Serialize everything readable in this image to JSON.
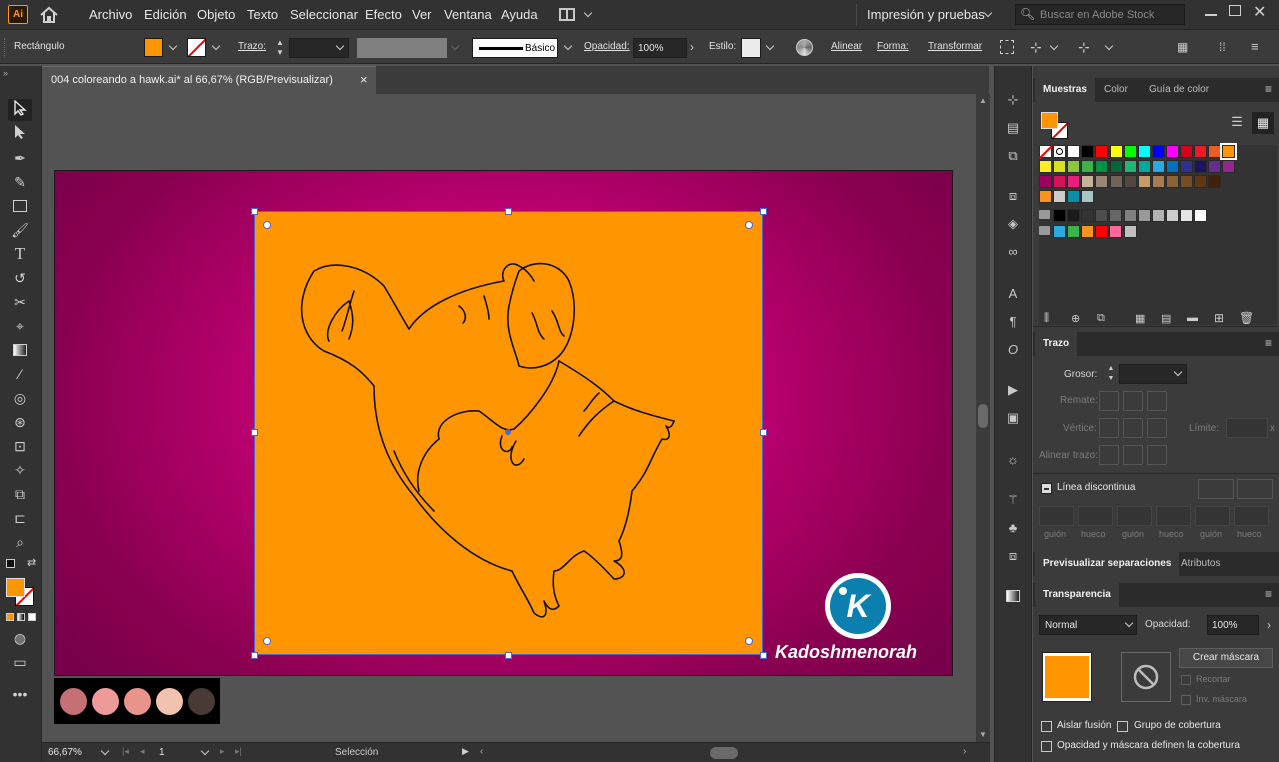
{
  "app": {
    "logo": "Ai",
    "home_icon": "home-icon"
  },
  "menu": [
    "Archivo",
    "Edición",
    "Objeto",
    "Texto",
    "Seleccionar",
    "Efecto",
    "Ver",
    "Ventana",
    "Ayuda"
  ],
  "workspace": "Impresión y pruebas",
  "search": {
    "placeholder": "Buscar en Adobe Stock"
  },
  "control": {
    "object_type": "Rectángulo",
    "fill_color": "#ff9500",
    "stroke_label": "Trazo:",
    "brush_label": "Básico",
    "opacity_label": "Opacidad:",
    "opacity_value": "100%",
    "style_label": "Estilo:",
    "align_label": "Alinear",
    "shape_label": "Forma:",
    "transform_label": "Transformar"
  },
  "document": {
    "tab_title": "004 coloreando a hawk.ai* al 66,67% (RGB/Previsualizar)",
    "close": "×"
  },
  "artboard": {
    "bg_color": "#c0006a",
    "rect_color": "#ff9500",
    "watermark": "Kadoshmenorah",
    "logo_letter": "K"
  },
  "palette": [
    "#c47074",
    "#ef9a9a",
    "#e8948a",
    "#f2c2b0",
    "#4a3a36"
  ],
  "status": {
    "zoom": "66,67%",
    "artboard": "1",
    "mode": "Selección"
  },
  "swatches_panel": {
    "tabs": [
      "Muestras",
      "Color",
      "Guía de color"
    ],
    "rows": [
      [
        "none",
        "reg",
        "#ffffff",
        "#000000",
        "#ff0000",
        "#ffff00",
        "#00ff00",
        "#00ffff",
        "#0000ff",
        "#ff00ff",
        "#d4001e",
        "#ed1c24",
        "#f15a24",
        "#ff9500"
      ],
      [
        "#fcee21",
        "#d9e021",
        "#8cc63f",
        "#39b54a",
        "#009245",
        "#006837",
        "#22b573",
        "#00a99d",
        "#29abe2",
        "#0071bc",
        "#2e3192",
        "#1b1464",
        "#662d91",
        "#93278f"
      ],
      [
        "#9e005d",
        "#d4145a",
        "#ed1e79",
        "#c7b299",
        "#998675",
        "#736357",
        "#534741",
        "#c69c6d",
        "#a67c52",
        "#8c6239",
        "#754c24",
        "#603813",
        "#42210b"
      ],
      [
        "#f7931e",
        "#cccccc",
        "#0a8fa8",
        "#aac5c5"
      ],
      [
        "#000000",
        "#1a1a1a",
        "#333333",
        "#4d4d4d",
        "#666666",
        "#808080",
        "#999999",
        "#b3b3b3",
        "#cccccc",
        "#e6e6e6",
        "#ffffff"
      ],
      [
        "#29abe2",
        "#39b54a",
        "#f7931e",
        "#ff0000",
        "#ff6699",
        "#c0c0c0"
      ]
    ]
  },
  "stroke_panel": {
    "title": "Trazo",
    "weight_label": "Grosor:",
    "cap_label": "Remate:",
    "corner_label": "Vértice:",
    "limit_label": "Límite:",
    "limit_x": "x",
    "align_label": "Alinear trazo:",
    "dashed_label": "Línea discontinua",
    "dash_labels": [
      "guión",
      "hueco",
      "guión",
      "hueco",
      "guión",
      "hueco"
    ]
  },
  "sep_panel": {
    "tabs": [
      "Previsualizar separaciones",
      "Atributos"
    ]
  },
  "transparency_panel": {
    "title": "Transparencia",
    "blend_mode": "Normal",
    "opacity_label": "Opacidad:",
    "opacity_value": "100%",
    "make_mask": "Crear máscara",
    "clip": "Recortar",
    "invert": "Inv. máscara",
    "isolate": "Aislar fusión",
    "knockout": "Grupo de cobertura",
    "opacity_mask": "Opacidad y máscara definen la cobertura"
  }
}
